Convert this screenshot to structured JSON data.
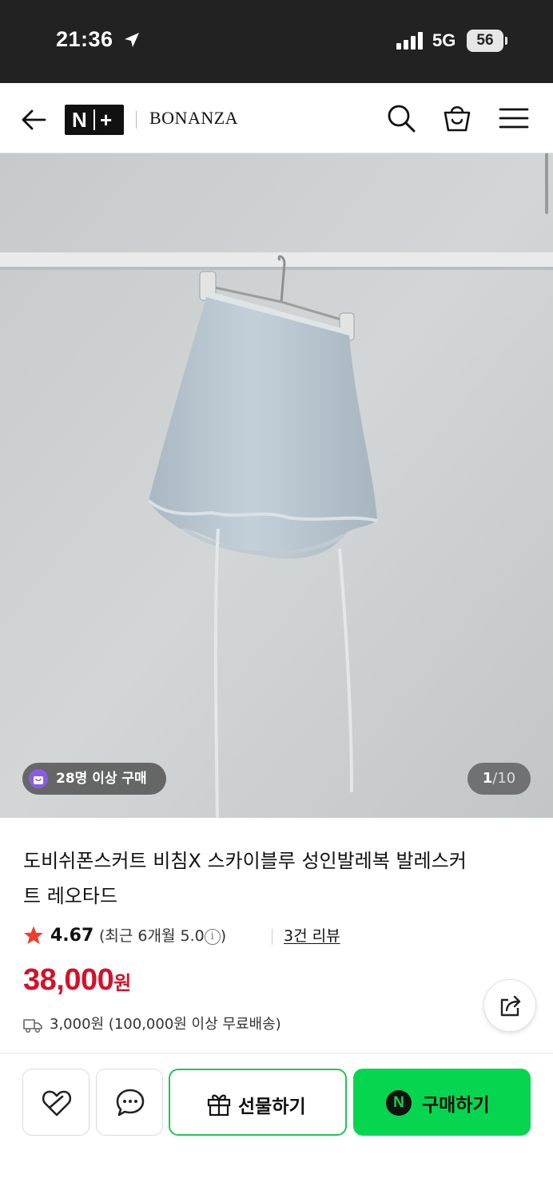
{
  "status_bar": {
    "time": "21:36",
    "network": "5G",
    "battery": "56"
  },
  "header": {
    "logo_text": "N+",
    "brand": "BONANZA",
    "icons": [
      "back-arrow-icon",
      "search-icon",
      "shopping-bag-icon",
      "menu-icon"
    ]
  },
  "gallery": {
    "buyers_badge": "28명 이상 구매",
    "current_index": "1",
    "total": "10",
    "total_label": "/10"
  },
  "product": {
    "title": "도비쉬폰스커트 비침X 스카이블루 성인발레복 발레스커트 레오타드",
    "rating": "4.67",
    "recent_rating_prefix": "(최근 6개월 5.0",
    "recent_rating_suffix": ")",
    "review_count": "3건 리뷰",
    "price": "38,000",
    "price_unit": "원",
    "shipping": "3,000원 (100,000원 이상 무료배송)"
  },
  "actions": {
    "gift_label": "선물하기",
    "buy_label": "구매하기",
    "npay_mark": "N"
  },
  "colors": {
    "price": "#d3122a",
    "buy_green": "#06d64f",
    "star": "#f03e29"
  }
}
